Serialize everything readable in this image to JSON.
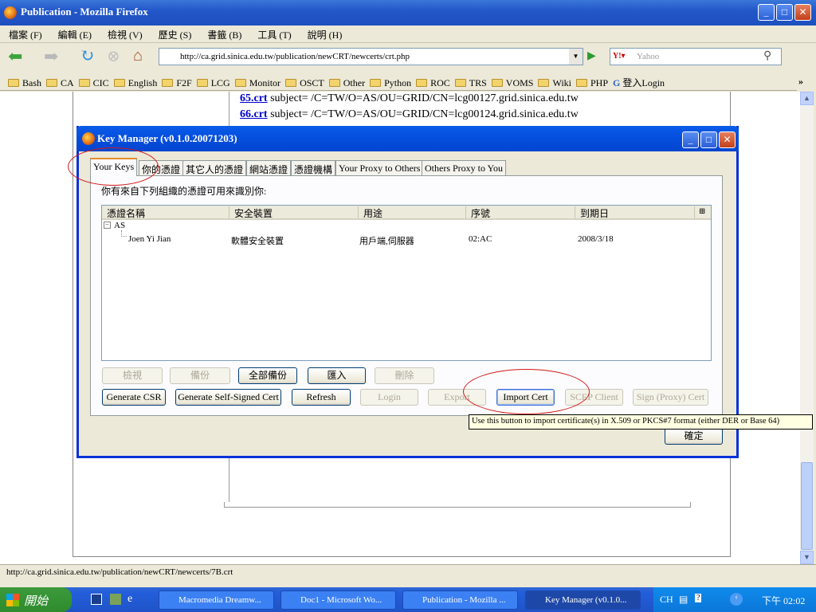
{
  "browser": {
    "title": "Publication - Mozilla Firefox",
    "menu": [
      "檔案 (F)",
      "編輯 (E)",
      "檢視 (V)",
      "歷史 (S)",
      "書籤 (B)",
      "工具 (T)",
      "說明 (H)"
    ],
    "url": "http://ca.grid.sinica.edu.tw/publication/newCRT/newcerts/crt.php",
    "search_placeholder": "Yahoo",
    "bookmarks": [
      "Bash",
      "CA",
      "CIC",
      "English",
      "F2F",
      "LCG",
      "Monitor",
      "OSCT",
      "Other",
      "Python",
      "ROC",
      "TRS",
      "VOMS",
      "Wiki",
      "PHP"
    ],
    "login_bookmark": "登入Login",
    "status": "http://ca.grid.sinica.edu.tw/publication/newCRT/newcerts/7B.crt"
  },
  "page": {
    "lines": [
      {
        "link": "65.crt",
        "text": " subject= /C=TW/O=AS/OU=GRID/CN=lcg00127.grid.sinica.edu.tw"
      },
      {
        "link": "66.crt",
        "text": " subject= /C=TW/O=AS/OU=GRID/CN=lcg00124.grid.sinica.edu.tw"
      }
    ]
  },
  "dialog": {
    "title": "Key Manager (v0.1.0.20071203)",
    "tabs": [
      "Your Keys",
      "你的憑證",
      "其它人的憑證",
      "網站憑證",
      "憑證機構",
      "Your Proxy to Others",
      "Others Proxy to You"
    ],
    "description": "你有來自下列組織的憑證可用來識別你:",
    "columns": [
      "憑證名稱",
      "安全裝置",
      "用途",
      "序號",
      "到期日"
    ],
    "group": "AS",
    "rows": [
      {
        "name": "Joen Yi Jian",
        "device": "軟體安全裝置",
        "usage": "用戶端,伺服器",
        "serial": "02:AC",
        "expires": "2008/3/18"
      }
    ],
    "buttons_row1": [
      {
        "label": "檢視",
        "enabled": false
      },
      {
        "label": "備份",
        "enabled": false
      },
      {
        "label": "全部備份",
        "enabled": true
      },
      {
        "label": "匯入",
        "enabled": true
      },
      {
        "label": "刪除",
        "enabled": false
      }
    ],
    "buttons_row2": [
      {
        "label": "Generate CSR",
        "enabled": true
      },
      {
        "label": "Generate Self-Signed Cert",
        "enabled": true
      },
      {
        "label": "Refresh",
        "enabled": true
      },
      {
        "label": "Login",
        "enabled": false
      },
      {
        "label": "Export",
        "enabled": false
      },
      {
        "label": "Import Cert",
        "enabled": true
      },
      {
        "label": "SCEP Client",
        "enabled": false
      },
      {
        "label": "Sign (Proxy) Cert",
        "enabled": false
      }
    ],
    "ok": "確定",
    "tooltip": "Use this button to import certificate(s) in X.509 or PKCS#7 format (either DER or Base 64)"
  },
  "taskbar": {
    "start": "開始",
    "tasks": [
      "Macromedia Dreamw...",
      "Doc1 - Microsoft Wo...",
      "Publication - Mozilla ...",
      "Key Manager (v0.1.0..."
    ],
    "lang": "CH",
    "clock": "下午 02:02"
  },
  "colors": {
    "annotation": "#d41818",
    "xp_blue": "#0a5ce8"
  }
}
